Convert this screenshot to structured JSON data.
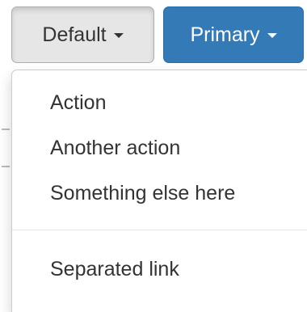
{
  "buttons": {
    "default_label": "Default",
    "primary_label": "Primary"
  },
  "dropdown": {
    "items": [
      {
        "label": "Action"
      },
      {
        "label": "Another action"
      },
      {
        "label": "Something else here"
      }
    ],
    "separated_item": {
      "label": "Separated link"
    }
  },
  "colors": {
    "default_button_bg": "#e6e6e6",
    "primary_button_bg": "#337ab7",
    "menu_text": "#333333",
    "divider": "#e5e5e5"
  },
  "icons": {
    "caret": "caret-down-icon"
  }
}
